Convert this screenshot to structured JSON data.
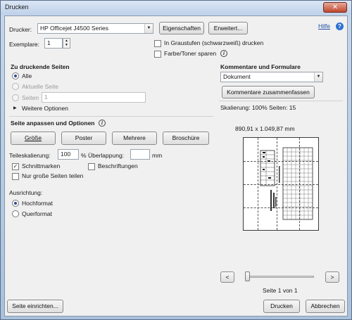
{
  "window": {
    "title": "Drucken",
    "close_glyph": "✕"
  },
  "help": {
    "label": "Hilfe",
    "icon": "help-icon",
    "icon_glyph": "?"
  },
  "printer": {
    "label": "Drucker:",
    "selected": "HP Officejet J4500 Series",
    "properties_button": "Eigenschaften",
    "advanced_button": "Erweitert..."
  },
  "copies": {
    "label": "Exemplare:",
    "value": "1"
  },
  "options": {
    "grayscale": {
      "label": "In Graustufen (schwarzweiß) drucken",
      "checked": false
    },
    "save_ink": {
      "label": "Farbe/Toner sparen",
      "checked": false
    }
  },
  "pages_section": {
    "heading": "Zu druckende Seiten",
    "all": "Alle",
    "current": "Aktuelle Seite",
    "pages": "Seiten",
    "pages_value": "1",
    "more_options": "Weitere Optionen"
  },
  "sizing_section": {
    "heading": "Seite anpassen und Optionen",
    "buttons": [
      "Größe",
      "Poster",
      "Mehrere",
      "Broschüre"
    ],
    "tile_scale_label": "Teileskalierung:",
    "tile_scale_value": "100",
    "percent": "%",
    "overlap_label": "Überlappung:",
    "overlap_value": "",
    "overlap_unit": "mm",
    "cut_marks": {
      "label": "Schnittmarken",
      "checked": true
    },
    "labels": {
      "label": "Beschriftungen",
      "checked": false
    },
    "large_only": {
      "label": "Nur große Seiten teilen",
      "checked": false
    }
  },
  "orientation": {
    "heading": "Ausrichtung:",
    "portrait": "Hochformat",
    "landscape": "Querformat",
    "selected": "portrait"
  },
  "comments": {
    "heading": "Kommentare und Formulare",
    "selected": "Dokument",
    "summarize_button": "Kommentare zusammenfassen",
    "scaling_text": "Skalierung: 100% Seiten: 15"
  },
  "preview": {
    "dimensions": "890,91 x 1.049,87 mm",
    "page_indicator": "Seite 1 von 1",
    "prev": "<",
    "next": ">"
  },
  "footer": {
    "page_setup": "Seite einrichten...",
    "print": "Drucken",
    "cancel": "Abbrechen"
  },
  "checkmark_glyph": "✓",
  "arrow_glyph": "▼",
  "expand_glyph": "▶",
  "info_glyph": "i",
  "spin_up": "▲",
  "spin_down": "▼"
}
